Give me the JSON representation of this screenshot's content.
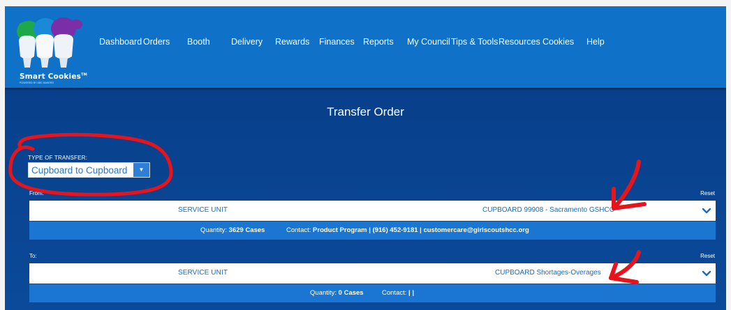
{
  "logo": {
    "text": "Smart Cookies",
    "tm": "TM",
    "sub": "POWERED BY ABC BAKERS"
  },
  "nav": [
    {
      "label": "Dashboard"
    },
    {
      "label": "Orders"
    },
    {
      "label": "Booth"
    },
    {
      "label": "Delivery"
    },
    {
      "label": "Rewards"
    },
    {
      "label": "Finances"
    },
    {
      "label": "Reports"
    },
    {
      "label": "My Council"
    },
    {
      "label": "Tips & Tools"
    },
    {
      "label": "Resources"
    },
    {
      "label": "Cookies"
    },
    {
      "label": "Help"
    }
  ],
  "page": {
    "title": "Transfer Order"
  },
  "transfer_type": {
    "label": "TYPE OF TRANSFER:",
    "value": "Cupboard to Cupboard"
  },
  "from": {
    "label": "From:",
    "reset": "Reset",
    "service_unit": "SERVICE UNIT",
    "cupboard": "CUPBOARD 99908 - Sacramento GSHCC",
    "quantity_label": "Quantity:",
    "quantity_value": "3629 Cases",
    "contact_label": "Contact:",
    "contact_value": "Product Program | (916) 452-9181 | customercare@girlscoutshcc.org"
  },
  "to": {
    "label": "To:",
    "reset": "Reset",
    "service_unit": "SERVICE UNIT",
    "cupboard": "CUPBOARD Shortages-Overages",
    "quantity_label": "Quantity:",
    "quantity_value": "0 Cases",
    "contact_label": "Contact:",
    "contact_value": "| |"
  },
  "colors": {
    "header": "#0f71c8",
    "main_background": "#0b4a9a",
    "info_bar": "#1a76d0",
    "annotation": "#e8141b"
  }
}
